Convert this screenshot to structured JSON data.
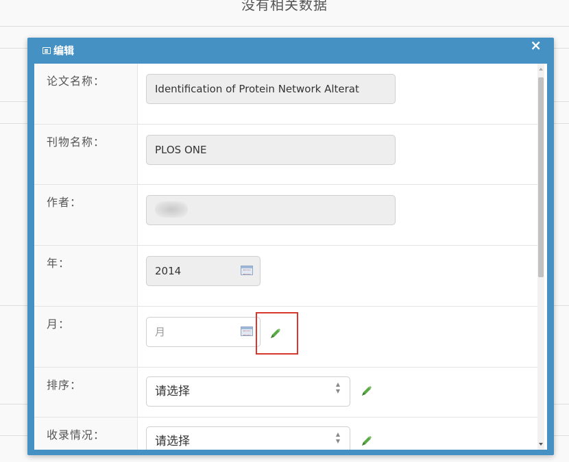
{
  "background": {
    "top_text": "没有相关数据"
  },
  "modal": {
    "title": "编辑",
    "close_label": "×",
    "fields": [
      {
        "label": "论文名称：",
        "value": "Identification of Protein Network Alterat"
      },
      {
        "label": "刊物名称：",
        "value": "PLOS ONE"
      },
      {
        "label": "作者：",
        "value": ""
      },
      {
        "label": "年：",
        "value": "2014"
      },
      {
        "label": "月：",
        "placeholder": "月"
      },
      {
        "label": "排序：",
        "selected": "请选择"
      },
      {
        "label": "收录情况：",
        "selected": "请选择"
      }
    ]
  },
  "icons": {
    "calendar": "calendar-icon",
    "pencil": "pencil-icon",
    "close": "close-icon",
    "title": "edit-form-icon"
  },
  "colors": {
    "header_blue": "#4591c3",
    "pencil_green": "#5aa846",
    "highlight_red": "#d9372e"
  }
}
